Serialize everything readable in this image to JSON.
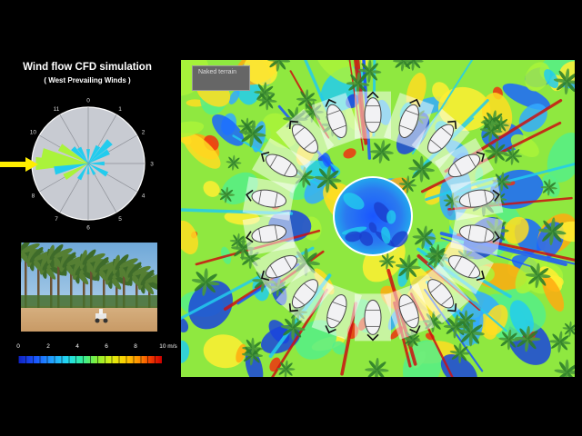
{
  "title": "Wind flow CFD simulation",
  "subtitle": "( West Prevailing Winds )",
  "rose": {
    "labels": [
      "0",
      "1",
      "2",
      "3",
      "4",
      "5",
      "6",
      "7",
      "8",
      "9",
      "10",
      "11"
    ],
    "colors": {
      "face": "#c8cbd2",
      "ring": "#ffffff",
      "spokes": "#8c8f96",
      "cyan": "#22ccee",
      "lime": "#aaf33a",
      "arrow": "#ffee00"
    }
  },
  "scale": {
    "labels": [
      "0",
      "2",
      "4",
      "6",
      "8",
      "10 m/s"
    ],
    "values": [
      0,
      2,
      4,
      6,
      8,
      10
    ]
  },
  "panel": {
    "badge": "Naked terrain",
    "units": 18
  }
}
